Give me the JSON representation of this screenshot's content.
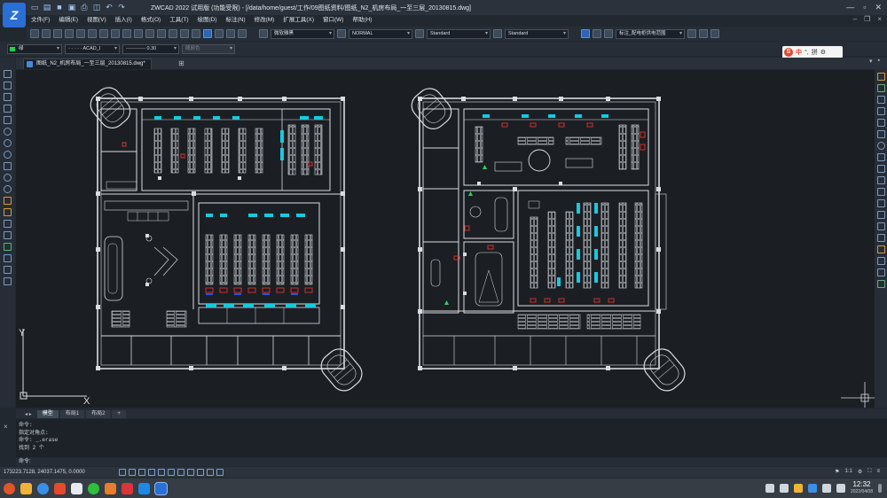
{
  "app": {
    "title": "ZWCAD 2022 试用版 (功能受限) - [/data/home/guest/工作/09图纸资料/图纸_N2_机房布局_一至三层_20130815.dwg]"
  },
  "menu": [
    "文件(F)",
    "编辑(E)",
    "视图(V)",
    "插入(I)",
    "格式(O)",
    "工具(T)",
    "绘图(D)",
    "标注(N)",
    "修改(M)",
    "扩展工具(X)",
    "窗口(W)",
    "帮助(H)"
  ],
  "toolbar": {
    "textstyle": "微软雅黑",
    "dimstyle": "NORMAL",
    "tablestyle": "Standard",
    "mleaderstyle": "Standard",
    "layer_right": "标注_配电柜供电范围"
  },
  "properties": {
    "color": "绿",
    "linetype": "ACAD_I",
    "lineweight": "0.30",
    "plotstyle": "随颜色"
  },
  "ime": {
    "logo": "S",
    "lang": "中",
    "mode": "拼"
  },
  "document_tab": "图纸_N2_机房布局_一至三层_20130815.dwg*",
  "layout_tabs": [
    "模型",
    "布局1",
    "布局2"
  ],
  "command_history": [
    "命令:",
    "指定对角点:",
    "命令: _.erase",
    "找到 2 个"
  ],
  "command_prompt": "命令:",
  "status": {
    "coords": "173223.7128, 24037.1475, 0.0000",
    "scale": "1:1"
  },
  "clock": {
    "time": "12:32",
    "date": "2022/04/08"
  },
  "colors": {
    "canvas_bg": "#1b1f24",
    "linework": "#d9dde2",
    "cyan_equipment": "#19c8e0",
    "red_marks": "#e0332b",
    "accent": "#2a67b8"
  }
}
